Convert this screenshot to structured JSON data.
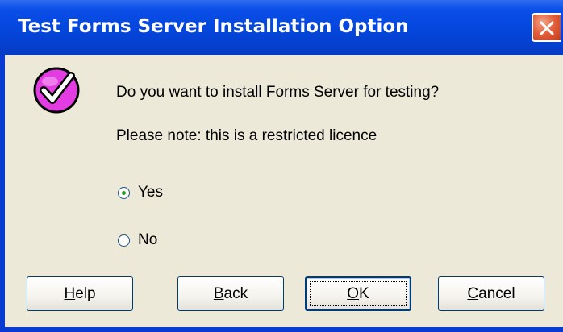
{
  "window": {
    "title": "Test Forms Server Installation Option"
  },
  "icons": {
    "app": "checkmark-circle-icon",
    "close": "close-icon"
  },
  "colors": {
    "titlebar": "#0446dc",
    "dialog_bg": "#ece9d8",
    "icon_fill": "#e23ce2",
    "close_button": "#e2603c"
  },
  "dialog": {
    "question": "Do you want to install Forms Server for testing?",
    "note": "Please note: this is a restricted licence"
  },
  "options": {
    "yes": {
      "label": "Yes",
      "selected": true
    },
    "no": {
      "label": "No",
      "selected": false
    }
  },
  "buttons": {
    "help": {
      "accel": "H",
      "rest": "elp"
    },
    "back": {
      "accel": "B",
      "rest": "ack"
    },
    "ok": {
      "accel": "O",
      "rest": "K"
    },
    "cancel": {
      "accel": "C",
      "rest": "ancel"
    }
  }
}
